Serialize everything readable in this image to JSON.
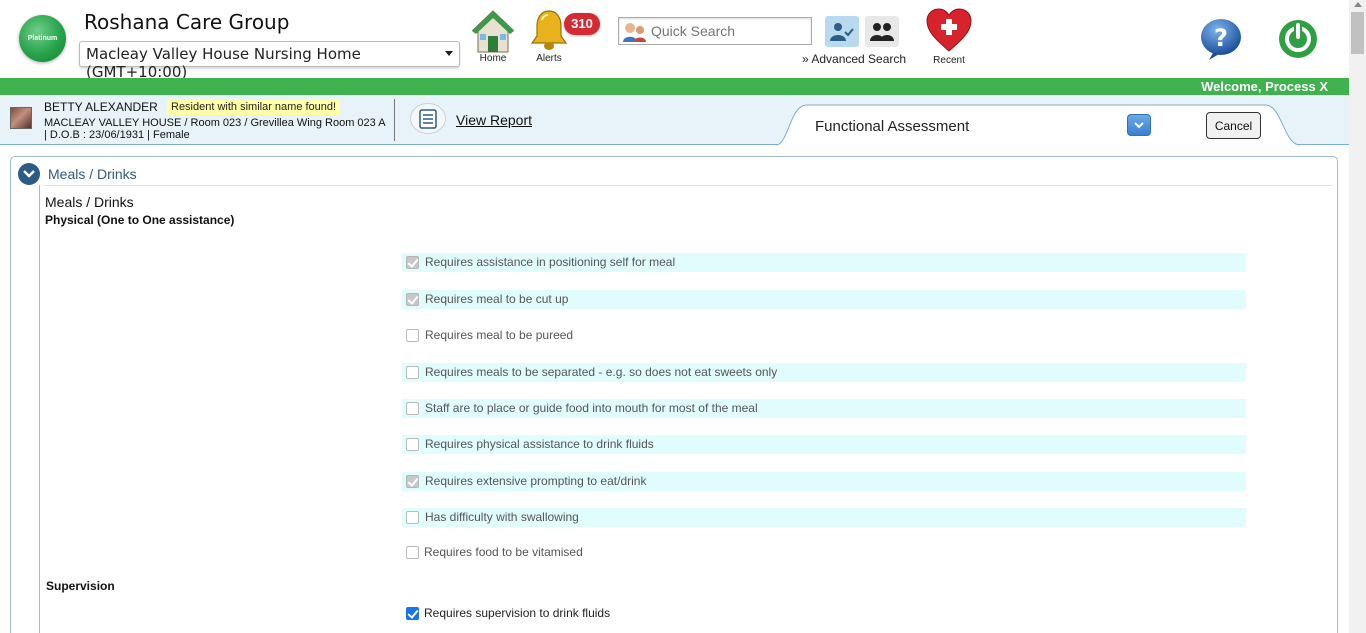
{
  "header": {
    "logo_text": "Platinum",
    "org_title": "Roshana Care Group",
    "facility": "Macleay Valley House Nursing Home (GMT+10:00)",
    "home_label": "Home",
    "alerts_label": "Alerts",
    "alerts_count": "310",
    "search_placeholder": "Quick Search",
    "advanced_search": "» Advanced Search",
    "recent_label": "Recent",
    "welcome": "Welcome, Process X"
  },
  "resident": {
    "name": "BETTY ALEXANDER",
    "similar_notice": "Resident with similar name found!",
    "location": "MACLEAY VALLEY HOUSE / Room 023 / Grevillea Wing Room 023 A",
    "dob": "| D.O.B : 23/06/1931 | Female",
    "view_report": "View Report"
  },
  "assessment": {
    "title": "Functional Assessment",
    "cancel": "Cancel"
  },
  "section": {
    "title": "Meals / Drinks",
    "label": "Meals / Drinks",
    "physical_heading": "Physical (One to One assistance)",
    "physical_options": [
      {
        "label": "Requires assistance in positioning self for meal",
        "checked": true
      },
      {
        "label": "Requires meal to be cut up",
        "checked": true
      },
      {
        "label": "Requires meal to be pureed",
        "checked": false
      },
      {
        "label": "Requires meals to be separated - e.g. so does not eat sweets only",
        "checked": false
      },
      {
        "label": "Staff are to place or guide food into mouth for most of the meal",
        "checked": false
      },
      {
        "label": "Requires physical assistance to drink fluids",
        "checked": false
      },
      {
        "label": "Requires extensive prompting to eat/drink",
        "checked": true
      },
      {
        "label": "Has difficulty with swallowing",
        "checked": false
      },
      {
        "label": "Requires food to be vitamised",
        "checked": false
      }
    ],
    "supervision_heading": "Supervision",
    "supervision_options": [
      {
        "label": "Requires supervision to drink fluids",
        "checked": true
      }
    ]
  },
  "colors": {
    "welcome_bar": "#3fb14f",
    "row_highlight": "#e0fcfc",
    "section_title": "#2e5a86",
    "alert_badge": "#d42a33"
  }
}
